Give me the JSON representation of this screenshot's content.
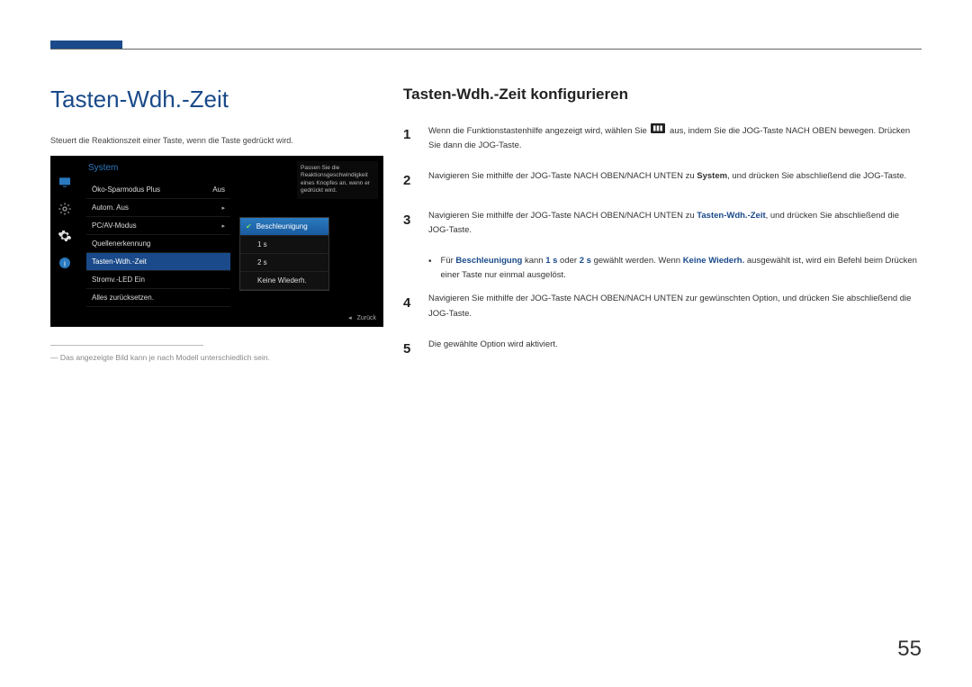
{
  "left": {
    "heading": "Tasten-Wdh.-Zeit",
    "desc": "Steuert die Reaktionszeit einer Taste, wenn die Taste gedrückt wird.",
    "footnote_dash": "―",
    "footnote": "Das angezeigte Bild kann je nach Modell unterschiedlich sein."
  },
  "osd": {
    "title": "System",
    "items": [
      {
        "label": "Öko-Sparmodus Plus",
        "value": "Aus"
      },
      {
        "label": "Autom. Aus",
        "value": "▸"
      },
      {
        "label": "PC/AV-Modus",
        "value": "▸"
      },
      {
        "label": "Quellenerkennung",
        "value": ""
      },
      {
        "label": "Tasten-Wdh.-Zeit",
        "value": ""
      },
      {
        "label": "Stromv.-LED Ein",
        "value": ""
      },
      {
        "label": "Alles zurücksetzen.",
        "value": ""
      }
    ],
    "submenu": [
      "Beschleunigung",
      "1 s",
      "2 s",
      "Keine Wiederh."
    ],
    "hint": "Passen Sie die Reaktionsgeschwindigkeit eines Knopfes an, wenn er gedrückt wird.",
    "back_arrow": "◂",
    "back": "Zurück"
  },
  "right": {
    "heading": "Tasten-Wdh.-Zeit konfigurieren",
    "steps": {
      "s1a": "Wenn die Funktionstastenhilfe angezeigt wird, wählen Sie ",
      "s1b": " aus, indem Sie die JOG-Taste NACH OBEN bewegen. Drücken Sie dann die JOG-Taste.",
      "s2a": "Navigieren Sie mithilfe der JOG-Taste NACH OBEN/NACH UNTEN zu ",
      "s2b": "System",
      "s2c": ", und drücken Sie abschließend die JOG-Taste.",
      "s3a": "Navigieren Sie mithilfe der JOG-Taste NACH OBEN/NACH UNTEN zu ",
      "s3b": "Tasten-Wdh.-Zeit",
      "s3c": ", und drücken Sie abschließend die JOG-Taste.",
      "bullet_a": "Für ",
      "bullet_b": "Beschleunigung",
      "bullet_c": " kann ",
      "bullet_d": "1 s",
      "bullet_e": " oder ",
      "bullet_f": "2 s",
      "bullet_g": " gewählt werden. Wenn ",
      "bullet_h": "Keine Wiederh.",
      "bullet_i": " ausgewählt ist, wird ein Befehl beim Drücken einer Taste nur einmal ausgelöst.",
      "s4": "Navigieren Sie mithilfe der JOG-Taste NACH OBEN/NACH UNTEN zur gewünschten Option, und drücken Sie abschließend die JOG-Taste.",
      "s5": "Die gewählte Option wird aktiviert."
    }
  },
  "page": "55"
}
